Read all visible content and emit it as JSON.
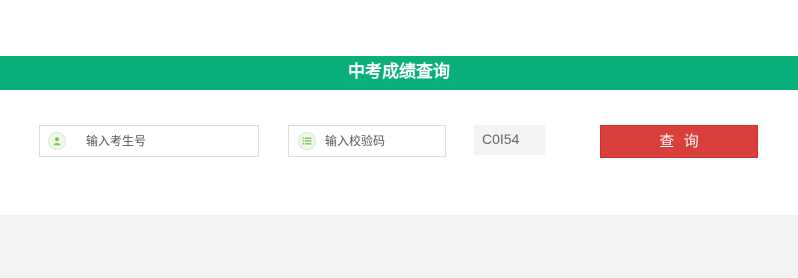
{
  "header": {
    "title": "中考成绩查询"
  },
  "form": {
    "student_id": {
      "placeholder": "输入考生号",
      "icon": "user-icon"
    },
    "verify_code": {
      "placeholder": "输入校验码",
      "icon": "list-icon"
    },
    "captcha_text": "C0I54",
    "submit_label": "查  询"
  },
  "colors": {
    "banner": "#0aaf7b",
    "button": "#d9403b",
    "icon_green": "#7cc45a",
    "footer": "#f2f2f2"
  }
}
